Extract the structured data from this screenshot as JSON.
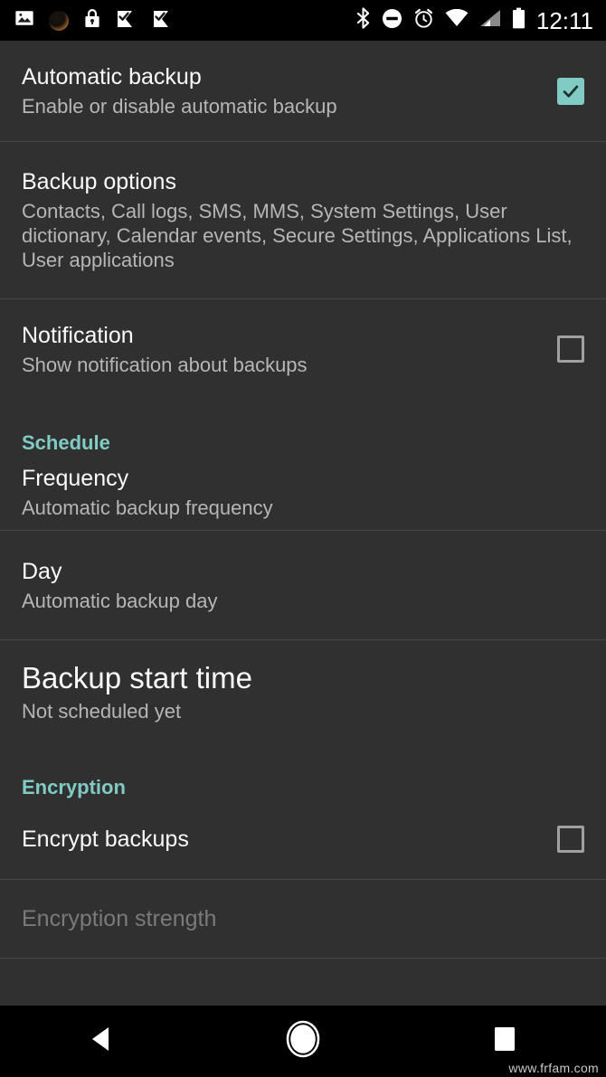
{
  "statusbar": {
    "time": "12:11",
    "left_icons": [
      {
        "name": "image-icon",
        "glyph": "image"
      },
      {
        "name": "app-icon",
        "glyph": "circle-app"
      },
      {
        "name": "lock-icon",
        "glyph": "lock"
      },
      {
        "name": "task-check-icon-1",
        "glyph": "check-flag"
      },
      {
        "name": "task-check-icon-2",
        "glyph": "check-flag"
      }
    ],
    "right_icons": [
      {
        "name": "bluetooth-icon",
        "glyph": "bluetooth"
      },
      {
        "name": "do-not-disturb-icon",
        "glyph": "dnd"
      },
      {
        "name": "alarm-icon",
        "glyph": "alarm"
      },
      {
        "name": "wifi-icon",
        "glyph": "wifi"
      },
      {
        "name": "signal-icon",
        "glyph": "signal"
      },
      {
        "name": "battery-icon",
        "glyph": "battery"
      }
    ]
  },
  "colors": {
    "accent_teal": "#80cbc4",
    "background": "#303030",
    "divider": "#474747",
    "title": "#fafafa",
    "summary": "#b6b6b6",
    "disabled": "#7a7a7a"
  },
  "settings": {
    "automatic_backup": {
      "title": "Automatic backup",
      "summary": "Enable or disable automatic backup",
      "checked": true
    },
    "backup_options": {
      "title": "Backup options",
      "summary": "Contacts, Call logs, SMS, MMS, System Settings, User dictionary, Calendar events, Secure Settings, Applications List, User applications"
    },
    "notification": {
      "title": "Notification",
      "summary": "Show notification about backups",
      "checked": false
    },
    "schedule_header": "Schedule",
    "frequency": {
      "title": "Frequency",
      "summary": "Automatic backup frequency"
    },
    "day": {
      "title": "Day",
      "summary": "Automatic backup day"
    },
    "backup_start_time": {
      "title": "Backup start time",
      "summary": "Not scheduled yet"
    },
    "encryption_header": "Encryption",
    "encrypt_backups": {
      "title": "Encrypt backups",
      "checked": false
    },
    "encryption_strength": {
      "title": "Encryption strength"
    }
  },
  "navbar": {
    "back_label": "Back",
    "home_label": "Home",
    "recents_label": "Recents",
    "watermark": "www.frfam.com"
  }
}
